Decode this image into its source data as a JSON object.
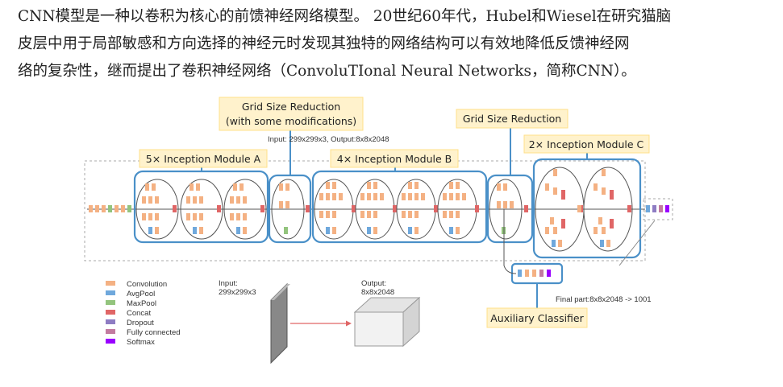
{
  "paragraph": {
    "line1": "CNN模型是一种以卷积为核心的前馈神经网络模型。 20世纪60年代，Hubel和Wiesel在研究猫脑",
    "line2": "皮层中用于局部敏感和方向选择的神经元时发现其独特的网络结构可以有效地降低反馈神经网",
    "line3": "络的复杂性，继而提出了卷积神经网络（ConvoluTIonal Neural Networks，简称CNN）。"
  },
  "diagram": {
    "io_label": "Input: 299x299x3, Output:8x8x2048",
    "callouts": {
      "module_a": "5× Inception Module A",
      "grid1_line1": "Grid Size Reduction",
      "grid1_line2": "(with some modifications)",
      "module_b": "4× Inception Module B",
      "grid2": "Grid Size Reduction",
      "module_c": "2× Inception Module C",
      "aux": "Auxiliary Classifier"
    },
    "final_part": "Final part:8x8x2048 -> 1001",
    "transform": {
      "input_l1": "Input:",
      "input_l2": "299x299x3",
      "output_l1": "Output:",
      "output_l2": "8x8x2048"
    },
    "legend": [
      {
        "label": "Convolution",
        "color": "#f4b183"
      },
      {
        "label": "AvgPool",
        "color": "#6fa8dc"
      },
      {
        "label": "MaxPool",
        "color": "#93c47d"
      },
      {
        "label": "Concat",
        "color": "#e06666"
      },
      {
        "label": "Dropout",
        "color": "#8e7cc3"
      },
      {
        "label": "Fully connected",
        "color": "#c27ba0"
      },
      {
        "label": "Softmax",
        "color": "#9900ff"
      }
    ],
    "colors": {
      "highlight": "#4a90c8",
      "callout_fill": "#fff2cc",
      "line": "#555555"
    }
  }
}
